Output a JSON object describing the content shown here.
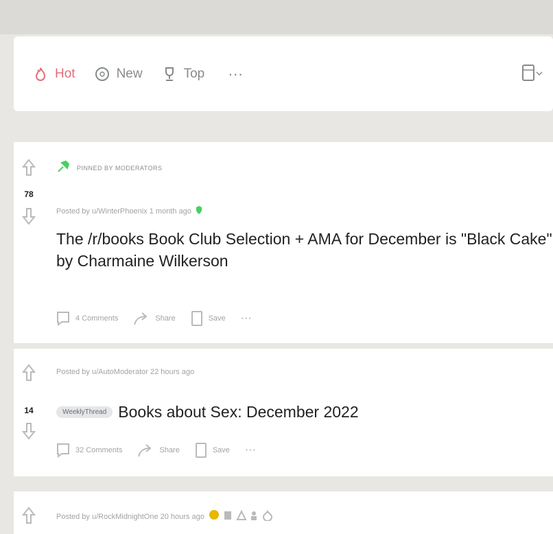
{
  "sort": {
    "hot": "Hot",
    "new": "New",
    "top": "Top",
    "more": "···"
  },
  "posts": [
    {
      "pinned": "PINNED BY MODERATORS",
      "votes": "78",
      "meta": "Posted by u/WinterPhoenix 1 month ago",
      "title_line1": "The /r/books Book Club Selection + AMA for December is \"Black Cake\"",
      "title_line2": "by Charmaine Wilkerson",
      "comments": "4 Comments",
      "share": "Share",
      "save": "Save",
      "more": "···"
    },
    {
      "votes": "14",
      "meta": "Posted by u/AutoModerator 22 hours ago",
      "flair": "WeeklyThread",
      "title": "Books about Sex: December 2022",
      "comments": "32 Comments",
      "share": "Share",
      "save": "Save",
      "more": "···"
    },
    {
      "meta": "Posted by u/RockMidnightOne 20 hours ago"
    }
  ],
  "colors": {
    "accent": "#e46d7a",
    "muted": "#878a8c",
    "pin_green": "#46d160",
    "award_gold": "#e6b800"
  }
}
